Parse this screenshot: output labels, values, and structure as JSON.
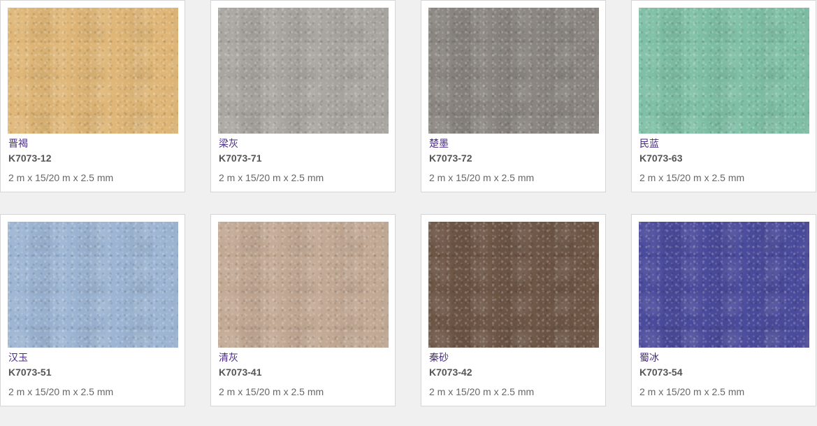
{
  "products": [
    {
      "name": "晋褐",
      "code": "K7073-12",
      "size": "2 m x 15/20 m x 2.5 mm",
      "color": "#dfb677"
    },
    {
      "name": "梁灰",
      "code": "K7073-71",
      "size": "2 m x 15/20 m x 2.5 mm",
      "color": "#a9a6a1"
    },
    {
      "name": "楚墨",
      "code": "K7073-72",
      "size": "2 m x 15/20 m x 2.5 mm",
      "color": "#8a8580"
    },
    {
      "name": "民蓝",
      "code": "K7073-63",
      "size": "2 m x 15/20 m x 2.5 mm",
      "color": "#7ebfa5"
    },
    {
      "name": "汉玉",
      "code": "K7073-51",
      "size": "2 m x 15/20 m x 2.5 mm",
      "color": "#9cb5d3"
    },
    {
      "name": "清灰",
      "code": "K7073-41",
      "size": "2 m x 15/20 m x 2.5 mm",
      "color": "#c2a994"
    },
    {
      "name": "秦砂",
      "code": "K7073-42",
      "size": "2 m x 15/20 m x 2.5 mm",
      "color": "#6e5646"
    },
    {
      "name": "蜀冰",
      "code": "K7073-54",
      "size": "2 m x 15/20 m x 2.5 mm",
      "color": "#4b4b9c"
    }
  ]
}
